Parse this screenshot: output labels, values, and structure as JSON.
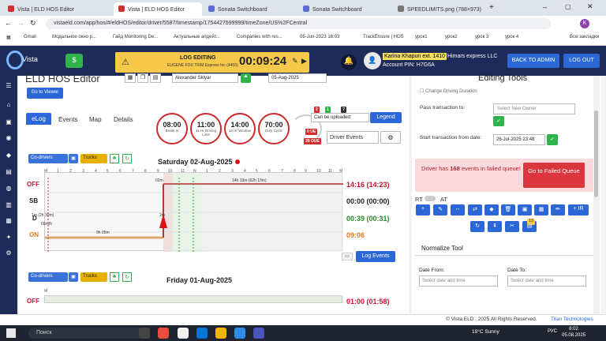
{
  "browser": {
    "tabs": [
      {
        "label": "Vista | ELD HOS Editor",
        "active": false,
        "color": "#d32f2f"
      },
      {
        "label": "Vista | ELD HOS Editor",
        "active": true,
        "color": "#d32f2f"
      },
      {
        "label": "Sonata Switchboard",
        "active": false,
        "color": "#5a6fd6"
      },
      {
        "label": "Sonata Switchboard",
        "active": false,
        "color": "#5a6fd6"
      },
      {
        "label": "SPEEDLIMITS.png (788×973)",
        "active": false,
        "color": "#777777"
      }
    ],
    "url": "vistaeld.com/app/hos/#/eldHOS/editor/driver/5587/timestamp/1754427599999/timeZone/US%2FCentral",
    "bookmarks": [
      "Gmail",
      "Модальное окно р...",
      "Гайд Monitoring De...",
      "Актуальные апдейт...",
      "Companies with res...",
      "05-Jun-2023 16:03",
      "TrackEnsure | HOS",
      "урок1",
      "урок2",
      "урок 3",
      "урок 4",
      "Все закладки"
    ]
  },
  "header": {
    "logo_text": "Vista",
    "log_label": "LOG EDITING",
    "log_sub": "EUGENE FOX  TRIM Express Inc (4455)",
    "log_time": "00:09:24",
    "driver_name": "Karina Khapun ext. 1410",
    "company": "Himars express LLC",
    "pin": "Account PIN: H7G6A",
    "back_admin": "BACK TO ADMIN",
    "logout": "LOG OUT"
  },
  "editor": {
    "title": "ELD HOS Editor",
    "driver_select": "Alexander Sklyar",
    "date_select": "05-Aug-2025",
    "goto_viewer": "Go to Viewer",
    "tabs": [
      "eLog",
      "Events",
      "Map",
      "Details"
    ],
    "timers": [
      {
        "value": "08:00",
        "label": "Break In"
      },
      {
        "value": "11:00",
        "label": "11 Hr Driving Limit"
      },
      {
        "value": "14:00",
        "label": "14 Hr Window"
      },
      {
        "value": "70:00",
        "label": "Duty Cycle"
      }
    ],
    "badges": [
      "2",
      "1",
      "?",
      "0 UE",
      "39 OUE"
    ],
    "can_upload": "Can be uploaded:",
    "legend": "Legend",
    "driver_events": "Driver Events",
    "codrivers": "Co-drivers",
    "trucks": "Trucks",
    "day1_title": "Saturday 02-Aug-2025",
    "day2_title": "Friday 01-Aug-2025",
    "row_labels": [
      "OFF",
      "SB",
      "D",
      "ON"
    ],
    "totals": [
      "14:16 (14:23)",
      "00:00 (00:00)",
      "00:39 (00:31)",
      "09:06"
    ],
    "hour_ticks": [
      "M",
      "1",
      "2",
      "3",
      "4",
      "5",
      "6",
      "7",
      "8",
      "9",
      "10",
      "11",
      "N",
      "1",
      "2",
      "3",
      "4",
      "5",
      "6",
      "7",
      "8",
      "9",
      "10",
      "11",
      "M"
    ],
    "annotations": [
      "14h 13m (62h 13m)",
      "1m (2h 30m)",
      "66m/h",
      "9h 05m",
      "02m",
      "2m"
    ],
    "log_events": "Log Events",
    "day2_offtotal": "01:00 (01:58)"
  },
  "tools": {
    "title": "Editing Tools",
    "change_driving": "Change Driving Duration",
    "pass_label": "Pass transaction to:",
    "new_owner_placeholder": "Select New Owner",
    "start_label": "Start transaction from date:",
    "start_value": "26-Jul-2025 23:48",
    "failed_prefix": "Driver has ",
    "failed_count": "168",
    "failed_suffix": " events in failed queue!",
    "failed_button": "Go to Failed Queue",
    "rt_label": "RT",
    "at_label": "AT",
    "tool_count_badge": "13",
    "normalize_title": "Normalize Tool",
    "date_from_label": "Date From:",
    "date_to_label": "Date To:",
    "date_placeholder": "Select date and time"
  },
  "footer": {
    "copyright": "© Vista ELD . 2025 All Rights Reserved.",
    "brand": "Titan Technologies"
  },
  "taskbar": {
    "search": "Поиск",
    "weather": "19°C  Sunny",
    "lang": "РУС",
    "time": "8:02",
    "date": "05.08.2025"
  },
  "colors": {
    "primary": "#2b67d6",
    "nav": "#1e2a57",
    "gold": "#f6c94b",
    "danger": "#cc2b2b",
    "success": "#2fb34a"
  }
}
